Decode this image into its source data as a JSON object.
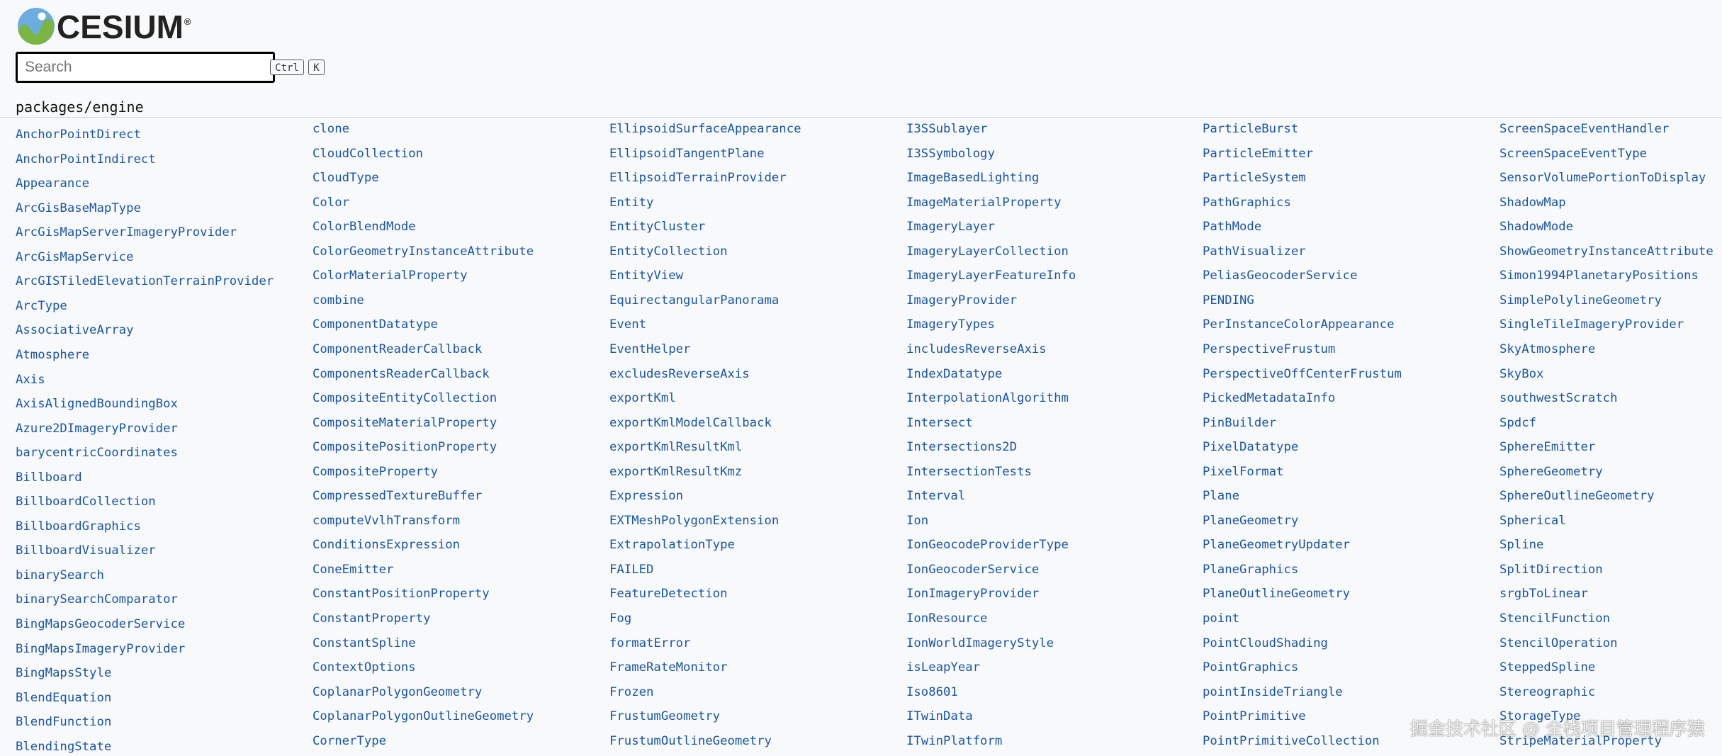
{
  "brand": {
    "name": "CESIUM",
    "registered_mark": "®",
    "logo_icon": "cesium-globe-logo"
  },
  "search": {
    "placeholder": "Search",
    "value": "",
    "shortcut_keys": [
      "Ctrl",
      "K"
    ]
  },
  "package": {
    "title": "packages/engine"
  },
  "colors": {
    "link": "#1a56a4",
    "background": "#f8f9fa",
    "search_border": "#000000"
  },
  "columns": [
    {
      "items": [
        "AnchorPointDirect",
        "AnchorPointIndirect",
        "Appearance",
        "ArcGisBaseMapType",
        "ArcGisMapServerImageryProvider",
        "ArcGisMapService",
        "ArcGISTiledElevationTerrainProvider",
        "ArcType",
        "AssociativeArray",
        "Atmosphere",
        "Axis",
        "AxisAlignedBoundingBox",
        "Azure2DImageryProvider",
        "barycentricCoordinates",
        "Billboard",
        "BillboardCollection",
        "BillboardGraphics",
        "BillboardVisualizer",
        "binarySearch",
        "binarySearchComparator",
        "BingMapsGeocoderService",
        "BingMapsImageryProvider",
        "BingMapsStyle",
        "BlendEquation",
        "BlendFunction",
        "BlendingState"
      ]
    },
    {
      "items": [
        "clone",
        "CloudCollection",
        "CloudType",
        "Color",
        "ColorBlendMode",
        "ColorGeometryInstanceAttribute",
        "ColorMaterialProperty",
        "combine",
        "ComponentDatatype",
        "ComponentReaderCallback",
        "ComponentsReaderCallback",
        "CompositeEntityCollection",
        "CompositeMaterialProperty",
        "CompositePositionProperty",
        "CompositeProperty",
        "CompressedTextureBuffer",
        "computeVvlhTransform",
        "ConditionsExpression",
        "ConeEmitter",
        "ConstantPositionProperty",
        "ConstantProperty",
        "ConstantSpline",
        "ContextOptions",
        "CoplanarPolygonGeometry",
        "CoplanarPolygonOutlineGeometry",
        "CornerType"
      ]
    },
    {
      "items": [
        "EllipsoidSurfaceAppearance",
        "EllipsoidTangentPlane",
        "EllipsoidTerrainProvider",
        "Entity",
        "EntityCluster",
        "EntityCollection",
        "EntityView",
        "EquirectangularPanorama",
        "Event",
        "EventHelper",
        "excludesReverseAxis",
        "exportKml",
        "exportKmlModelCallback",
        "exportKmlResultKml",
        "exportKmlResultKmz",
        "Expression",
        "EXTMeshPolygonExtension",
        "ExtrapolationType",
        "FAILED",
        "FeatureDetection",
        "Fog",
        "formatError",
        "FrameRateMonitor",
        "Frozen",
        "FrustumGeometry",
        "FrustumOutlineGeometry"
      ]
    },
    {
      "items": [
        "I3SSublayer",
        "I3SSymbology",
        "ImageBasedLighting",
        "ImageMaterialProperty",
        "ImageryLayer",
        "ImageryLayerCollection",
        "ImageryLayerFeatureInfo",
        "ImageryProvider",
        "ImageryTypes",
        "includesReverseAxis",
        "IndexDatatype",
        "InterpolationAlgorithm",
        "Intersect",
        "Intersections2D",
        "IntersectionTests",
        "Interval",
        "Ion",
        "IonGeocodeProviderType",
        "IonGeocoderService",
        "IonImageryProvider",
        "IonResource",
        "IonWorldImageryStyle",
        "isLeapYear",
        "Iso8601",
        "ITwinData",
        "ITwinPlatform"
      ]
    },
    {
      "items": [
        "ParticleBurst",
        "ParticleEmitter",
        "ParticleSystem",
        "PathGraphics",
        "PathMode",
        "PathVisualizer",
        "PeliasGeocoderService",
        "PENDING",
        "PerInstanceColorAppearance",
        "PerspectiveFrustum",
        "PerspectiveOffCenterFrustum",
        "PickedMetadataInfo",
        "PinBuilder",
        "PixelDatatype",
        "PixelFormat",
        "Plane",
        "PlaneGeometry",
        "PlaneGeometryUpdater",
        "PlaneGraphics",
        "PlaneOutlineGeometry",
        "point",
        "PointCloudShading",
        "PointGraphics",
        "pointInsideTriangle",
        "PointPrimitive",
        "PointPrimitiveCollection"
      ]
    },
    {
      "items": [
        "ScreenSpaceEventHandler",
        "ScreenSpaceEventType",
        "SensorVolumePortionToDisplay",
        "ShadowMap",
        "ShadowMode",
        "ShowGeometryInstanceAttribute",
        "Simon1994PlanetaryPositions",
        "SimplePolylineGeometry",
        "SingleTileImageryProvider",
        "SkyAtmosphere",
        "SkyBox",
        "southwestScratch",
        "Spdcf",
        "SphereEmitter",
        "SphereGeometry",
        "SphereOutlineGeometry",
        "Spherical",
        "Spline",
        "SplitDirection",
        "srgbToLinear",
        "StencilFunction",
        "StencilOperation",
        "SteppedSpline",
        "Stereographic",
        "StorageType",
        "StripeMaterialProperty"
      ]
    }
  ],
  "watermark": "掘金技术社区 @ 全栈项目管理程序猿"
}
